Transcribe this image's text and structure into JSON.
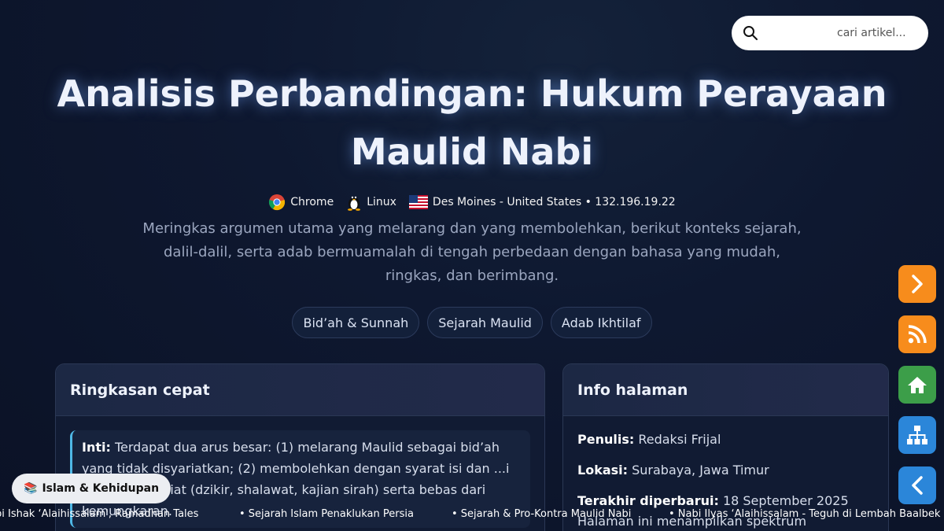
{
  "search": {
    "placeholder": "cari artikel...",
    "icon": "search-icon"
  },
  "title": "Analisis Perbandingan: Hukum Perayaan Maulid Nabi",
  "meta": {
    "browser": "Chrome",
    "os": "Linux",
    "location": "Des Moines - United States • 132.196.19.22"
  },
  "description": "Meringkas argumen utama yang melarang dan yang membolehkan, berikut konteks sejarah, dalil-dalil, serta adab bermuamalah di tengah perbedaan dengan bahasa yang mudah, ringkas, dan berimbang.",
  "tags": [
    "Bid’ah & Sunnah",
    "Sejarah Maulid",
    "Adab Ikhtilaf"
  ],
  "summary_card": {
    "title": "Ringkasan cepat",
    "lead": "Inti:",
    "body": " Terdapat dua arus besar: (1) melarang Maulid sebagai bid’ah yang tidak disyariatkan; (2) membolehkan dengan syarat isi dan ...i tuntunan syariat (dzikir, shalawat, kajian sirah) serta bebas dari kemungkaran."
  },
  "info_card": {
    "title": "Info halaman",
    "author_label": "Penulis:",
    "author": " Redaksi Frijal",
    "location_label": "Lokasi:",
    "location": " Surabaya, Jawa Timur",
    "updated_label": "Terakhir diperbarui:",
    "updated": " 18 September 2025",
    "note": "Halaman ini menampilkan spektrum"
  },
  "badge": {
    "icon": "books-icon",
    "label": "Islam & Kehidupan"
  },
  "ticker": [
    "bi Ishak ‘Alaihissalam', Ramadhan Tales",
    "• Sejarah Islam Penaklukan Persia",
    "• Sejarah & Pro-Kontra Maulid Nabi",
    "• Nabi Ilyas ‘Alaihissalam - Teguh di Lembah Baalbek"
  ],
  "colors": {
    "accent_orange": "#f78c1c",
    "accent_green": "#3c9e49",
    "accent_blue": "#2b86d9",
    "inti_border": "#4fb8e6"
  }
}
